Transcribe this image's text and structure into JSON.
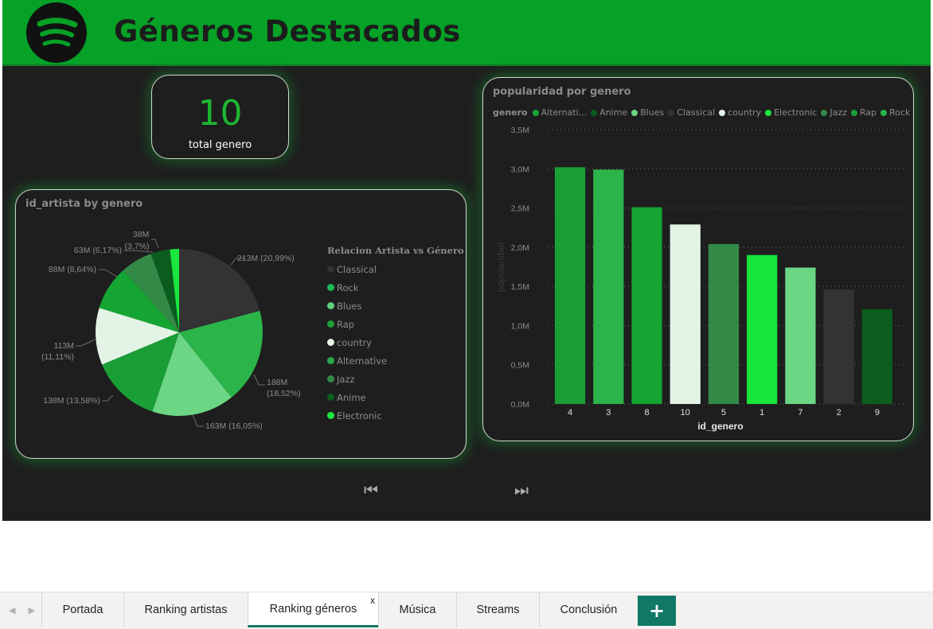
{
  "header": {
    "title": "Géneros Destacados",
    "logo_icon": "spotify-logo-icon"
  },
  "kpi": {
    "value": "10",
    "label": "total genero"
  },
  "pie": {
    "title": "id_artista by genero",
    "legend_title": "Relacion Artista vs Género",
    "legend": [
      {
        "label": "Classical",
        "color": "#333333"
      },
      {
        "label": "Rock",
        "color": "#1db954"
      },
      {
        "label": "Blues",
        "color": "#5fd07a"
      },
      {
        "label": "Rap",
        "color": "#1da23a"
      },
      {
        "label": "country",
        "color": "#e6f5e8"
      },
      {
        "label": "Alternative",
        "color": "#2aa84a"
      },
      {
        "label": "Jazz",
        "color": "#338a47"
      },
      {
        "label": "Anime",
        "color": "#0a5e1c"
      },
      {
        "label": "Electronic",
        "color": "#19e63c"
      }
    ],
    "labels": [
      "213M (20,99%)",
      "188M",
      "(18,52%)",
      "163M (16,05%)",
      "138M (13,58%)",
      "113M",
      "(11,11%)",
      "88M (8,64%)",
      "63M (6,17%)",
      "38M",
      "(3,7%)"
    ]
  },
  "chart_data": [
    {
      "type": "pie",
      "title": "id_artista by genero",
      "legend_title": "Relacion Artista vs Género",
      "legend_placement": "right",
      "slices": [
        {
          "genre": "Classical",
          "value": 213,
          "percent": 20.99,
          "color": "#333333"
        },
        {
          "genre": "Rock",
          "value": 188,
          "percent": 18.52,
          "color": "#2bb44a"
        },
        {
          "genre": "Blues",
          "value": 163,
          "percent": 16.05,
          "color": "#6bd683"
        },
        {
          "genre": "Rap",
          "value": 138,
          "percent": 13.58,
          "color": "#1a9e36"
        },
        {
          "genre": "country",
          "value": 113,
          "percent": 11.11,
          "color": "#e3f4e6"
        },
        {
          "genre": "Alternative",
          "value": 88,
          "percent": 8.64,
          "color": "#14a532"
        },
        {
          "genre": "Jazz",
          "value": 63,
          "percent": 6.17,
          "color": "#338a47"
        },
        {
          "genre": "Anime",
          "value": 38,
          "percent": 3.7,
          "color": "#0b5d1e"
        },
        {
          "genre": "Electronic",
          "value": 18,
          "percent": 1.78,
          "color": "#19e63c"
        }
      ],
      "unit": "M"
    },
    {
      "type": "bar",
      "title": "popularidad por genero",
      "xlabel": "id_genero",
      "ylabel": "popularidad",
      "legend_title": "genero",
      "legend": [
        {
          "label": "Alternati...",
          "color": "#14a532"
        },
        {
          "label": "Anime",
          "color": "#0b5d1e"
        },
        {
          "label": "Blues",
          "color": "#6bd683"
        },
        {
          "label": "Classical",
          "color": "#333333"
        },
        {
          "label": "country",
          "color": "#e3f4e6"
        },
        {
          "label": "Electronic",
          "color": "#19e63c"
        },
        {
          "label": "Jazz",
          "color": "#338a47"
        },
        {
          "label": "Rap",
          "color": "#1a9e36"
        },
        {
          "label": "Rock",
          "color": "#2bb44a"
        }
      ],
      "categories": [
        "4",
        "3",
        "8",
        "10",
        "5",
        "1",
        "7",
        "2",
        "9"
      ],
      "values": [
        3.02,
        2.99,
        2.51,
        2.29,
        2.04,
        1.9,
        1.74,
        1.46,
        1.21
      ],
      "colors": [
        "#1a9e36",
        "#2bb44a",
        "#14a532",
        "#e3f4e6",
        "#338a47",
        "#19e63c",
        "#6bd683",
        "#333333",
        "#0b5d1e"
      ],
      "yticks": [
        "0,0M",
        "0,5M",
        "1,0M",
        "1,5M",
        "2,0M",
        "2,5M",
        "3,0M",
        "3,5M"
      ],
      "ylim": [
        0,
        3.5
      ],
      "unit": "M",
      "grid": true,
      "legend_placement": "top"
    }
  ],
  "navigation": {
    "prev_icon": "skip-back-icon",
    "next_icon": "skip-forward-icon",
    "prev_glyph": "⏮",
    "next_glyph": "⏭"
  },
  "tabs": [
    {
      "label": "Portada"
    },
    {
      "label": "Ranking artistas"
    },
    {
      "label": "Ranking géneros",
      "active": true
    },
    {
      "label": "Música"
    },
    {
      "label": "Streams"
    },
    {
      "label": "Conclusión"
    }
  ],
  "tabbar": {
    "close_glyph": "x",
    "add_glyph": "+",
    "prev_glyph": "◀",
    "next_glyph": "▶"
  }
}
